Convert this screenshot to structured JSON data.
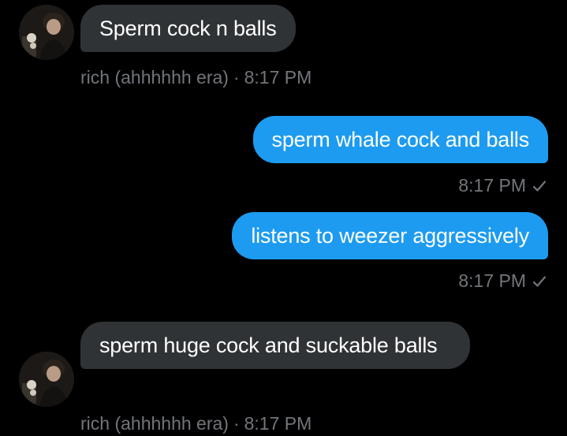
{
  "conversation": {
    "messages": [
      {
        "direction": "incoming",
        "text": "Sperm cock n balls",
        "sender": "rich (ahhhhhh era)",
        "separator": "·",
        "time": "8:17 PM",
        "avatar_icon": "user-avatar"
      },
      {
        "direction": "outgoing",
        "text": "sperm whale cock and balls",
        "time": "8:17 PM",
        "status_icon": "checkmark-icon"
      },
      {
        "direction": "outgoing",
        "text": "listens to weezer aggressively",
        "time": "8:17 PM",
        "status_icon": "checkmark-icon"
      },
      {
        "direction": "incoming",
        "text": "sperm huge cock and suckable balls",
        "sender": "rich (ahhhhhh era)",
        "separator": "·",
        "time": "8:17 PM",
        "avatar_icon": "user-avatar"
      }
    ]
  },
  "colors": {
    "background": "#000000",
    "incoming_bubble": "#2f3336",
    "outgoing_bubble": "#1d9bf0",
    "meta_text": "#71767b"
  }
}
